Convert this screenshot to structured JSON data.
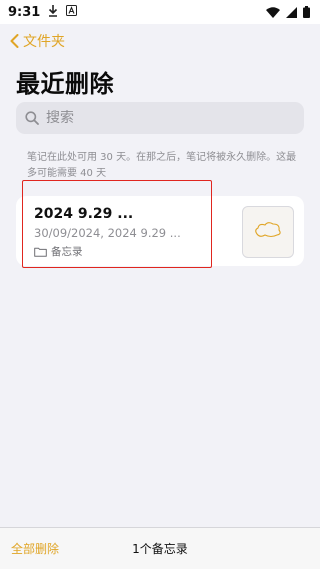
{
  "status_bar": {
    "time": "9:31",
    "icons": [
      "download-icon",
      "a-icon",
      "wifi-icon",
      "signal-icon",
      "battery-icon"
    ]
  },
  "nav": {
    "back_label": "文件夹",
    "accent": "#e0a526"
  },
  "page": {
    "title": "最近删除"
  },
  "search": {
    "placeholder": "搜索"
  },
  "notice": "笔记在此处可用 30 天。在那之后，笔记将被永久删除。这最多可能需要 40 天",
  "notes": [
    {
      "title": "2024 9.29 ...",
      "subtitle": "30/09/2024,  2024 9.29 ...",
      "folder": "备忘录"
    }
  ],
  "bottom_bar": {
    "delete_all_label": "全部删除",
    "count_label": "1个备忘录"
  },
  "colors": {
    "accent": "#e0a526",
    "highlight": "#e0261f",
    "background": "#f2f2f7"
  }
}
